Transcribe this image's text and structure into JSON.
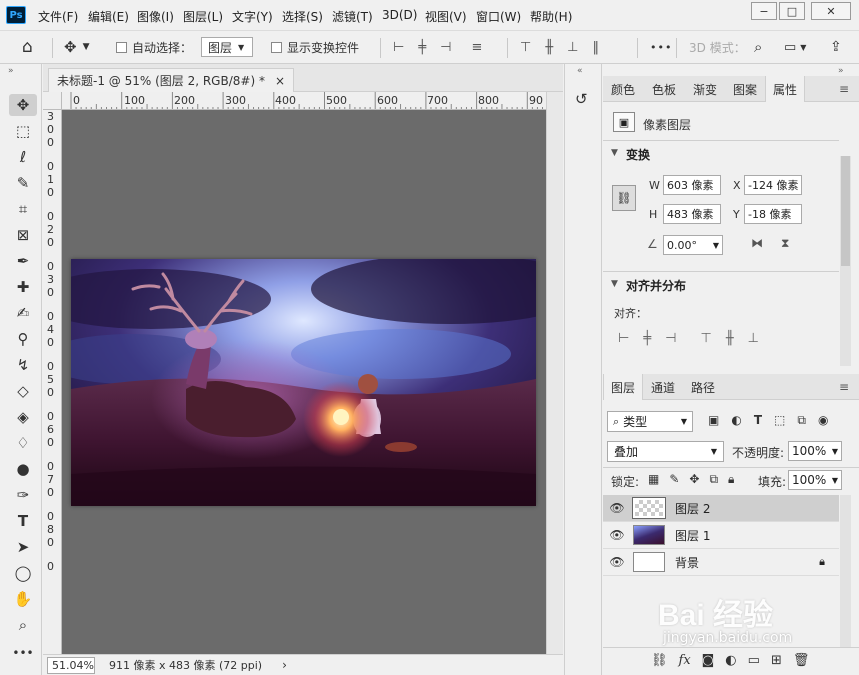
{
  "app": {
    "logo": "Ps",
    "menu": [
      "文件(F)",
      "编辑(E)",
      "图像(I)",
      "图层(L)",
      "文字(Y)",
      "选择(S)",
      "滤镜(T)",
      "3D(D)",
      "视图(V)",
      "窗口(W)",
      "帮助(H)"
    ],
    "window_buttons": [
      "−",
      "□",
      "✕"
    ]
  },
  "options_bar": {
    "auto_select_label": "自动选择：",
    "auto_select_value": "图层",
    "show_transform_label": "显示变换控件",
    "mode_3d_label": "3D 模式：",
    "more": "•••"
  },
  "document": {
    "tab_title": "未标题-1 @ 51% (图层 2, RGB/8#) *",
    "close": "×",
    "ruler_h": [
      "0",
      "100",
      "200",
      "300",
      "400",
      "500",
      "600",
      "700",
      "800",
      "90"
    ],
    "ruler_v": [
      "3",
      "0",
      "0",
      "0",
      "1",
      "0",
      "0",
      "2",
      "0",
      "0",
      "3",
      "0",
      "0",
      "4",
      "0",
      "0",
      "5",
      "0",
      "0",
      "6",
      "0",
      "0",
      "7",
      "0",
      "0",
      "8",
      "0",
      "0"
    ],
    "zoom": "51.04%",
    "status": "911 像素 x 483 像素 (72 ppi)",
    "status_arrow": "›"
  },
  "properties_panel": {
    "tabs": [
      "颜色",
      "色板",
      "渐变",
      "图案",
      "属性"
    ],
    "active_tab": "属性",
    "layer_type": "像素图层",
    "transform_title": "变换",
    "w_label": "W",
    "w_value": "603 像素",
    "h_label": "H",
    "h_value": "483 像素",
    "x_label": "X",
    "x_value": "-124 像素",
    "y_label": "Y",
    "y_value": "-18 像素",
    "angle_value": "0.00°",
    "align_title": "对齐并分布",
    "align_label": "对齐："
  },
  "layers_panel": {
    "tabs": [
      "图层",
      "通道",
      "路径"
    ],
    "active_tab": "图层",
    "filter_type": "类型",
    "blend_mode": "叠加",
    "opacity_label": "不透明度:",
    "opacity_value": "100%",
    "lock_label": "锁定:",
    "fill_label": "填充:",
    "fill_value": "100%",
    "layers": [
      {
        "name": "图层 2",
        "selected": true
      },
      {
        "name": "图层 1",
        "selected": false
      },
      {
        "name": "背景",
        "selected": false
      }
    ]
  },
  "watermark": {
    "brand": "Bai 经验",
    "url": "jingyan.baidu.com"
  },
  "colors": {
    "accent": "#31a8ff",
    "canvas_bg": "#6b6b6b",
    "panel_bg": "#f0f0f0"
  }
}
